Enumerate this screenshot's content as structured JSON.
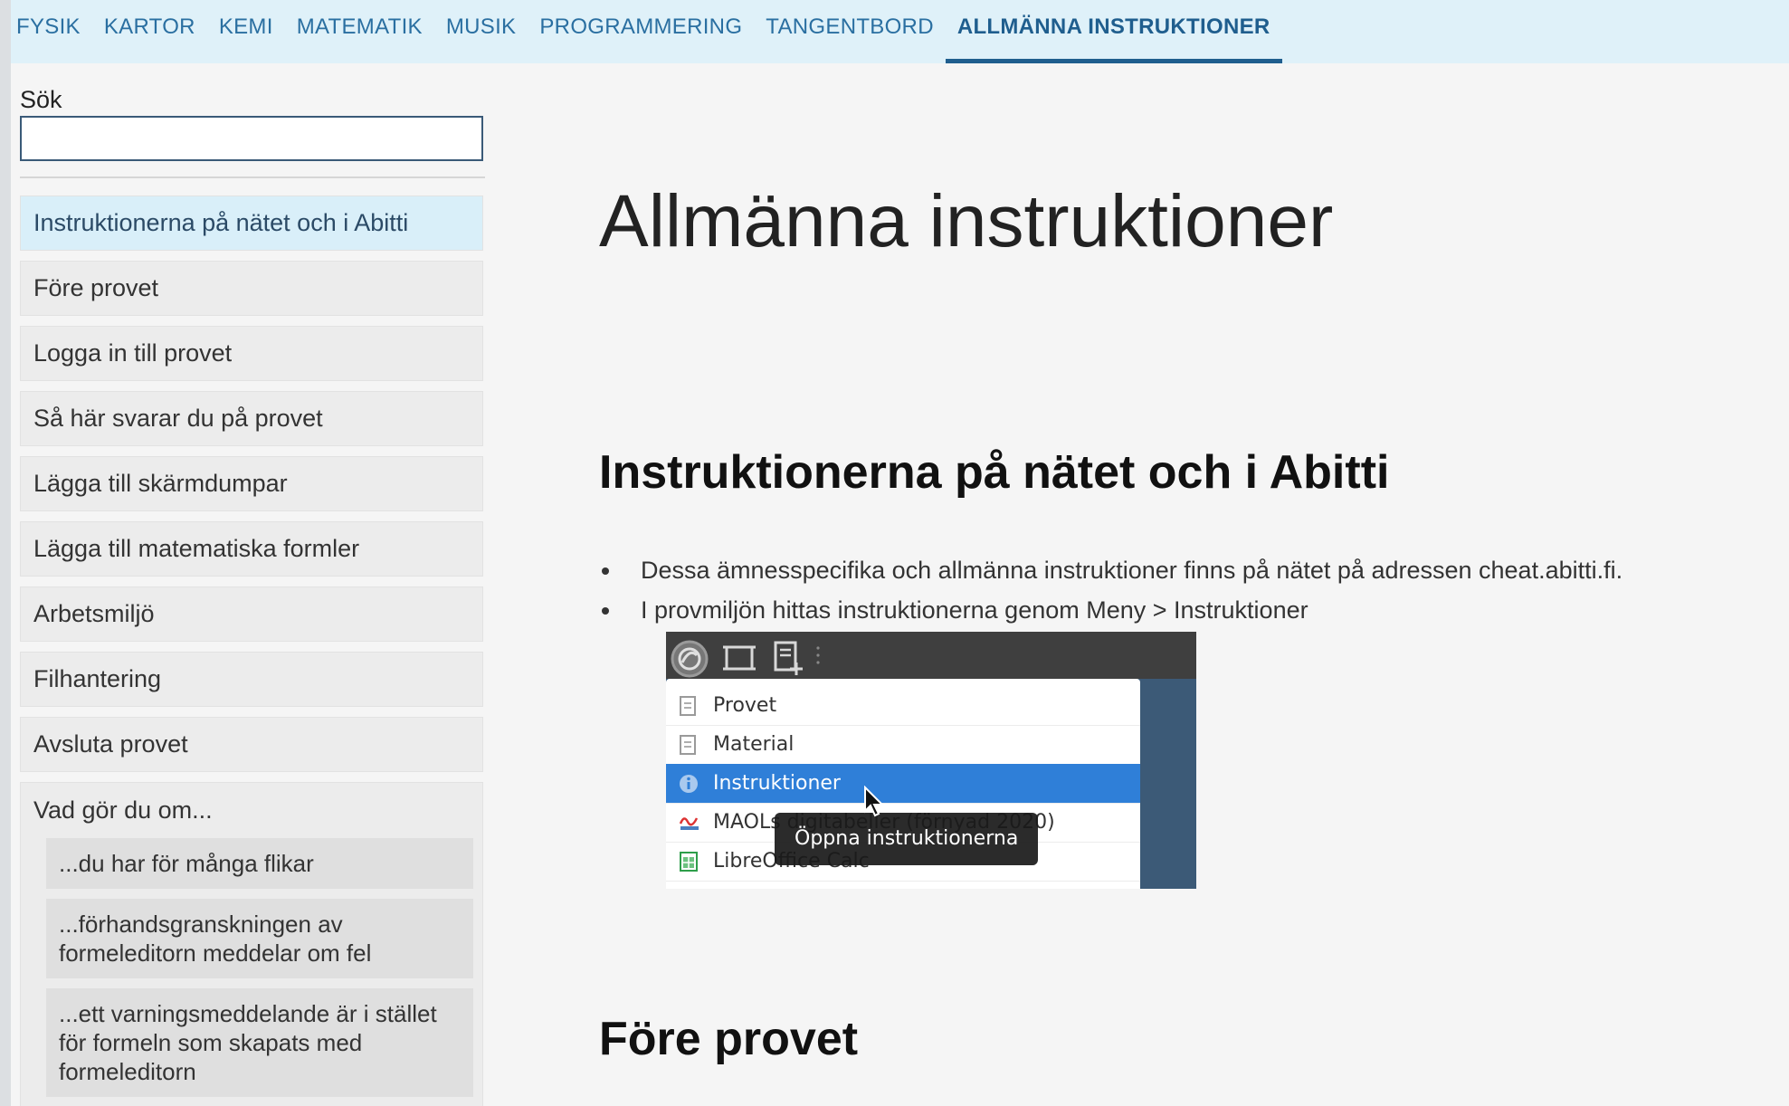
{
  "topnav": {
    "tabs": [
      {
        "label": "FYSIK"
      },
      {
        "label": "KARTOR"
      },
      {
        "label": "KEMI"
      },
      {
        "label": "MATEMATIK"
      },
      {
        "label": "MUSIK"
      },
      {
        "label": "PROGRAMMERING"
      },
      {
        "label": "TANGENTBORD"
      },
      {
        "label": "ALLMÄNNA INSTRUKTIONER",
        "active": true
      }
    ]
  },
  "sidebar": {
    "search_label": "Sök",
    "search_value": "",
    "items": [
      {
        "label": "Instruktionerna på nätet och i Abitti",
        "active": true
      },
      {
        "label": "Före provet"
      },
      {
        "label": "Logga in till provet"
      },
      {
        "label": "Så här svarar du på provet"
      },
      {
        "label": "Lägga till skärmdumpar"
      },
      {
        "label": "Lägga till matematiska formler"
      },
      {
        "label": "Arbetsmiljö"
      },
      {
        "label": "Filhantering"
      },
      {
        "label": "Avsluta provet"
      }
    ],
    "group": {
      "title": "Vad gör du om...",
      "subitems": [
        {
          "label": "...du har för många flikar"
        },
        {
          "label": "...förhandsgranskningen av formeleditorn meddelar om fel"
        },
        {
          "label": "...ett varningsmeddelande är i stället för formeln som skapats med formeleditorn"
        }
      ]
    }
  },
  "main": {
    "title": "Allmänna instruktioner",
    "sections": [
      {
        "heading": "Instruktionerna på nätet och i Abitti",
        "bullets": [
          "Dessa ämnesspecifika och allmänna instruktioner finns på nätet på adressen cheat.abitti.fi.",
          "I provmiljön hittas instruktionerna genom Meny > Instruktioner"
        ]
      },
      {
        "heading": "Före provet"
      }
    ],
    "screenshot": {
      "menu_items": [
        {
          "label": "Provet",
          "icon": "document-icon"
        },
        {
          "label": "Material",
          "icon": "document-icon"
        },
        {
          "label": "Instruktioner",
          "icon": "info-icon",
          "highlight": true
        },
        {
          "label": "MAOLs digitabeller (förnyad 2020)",
          "icon": "maol-icon"
        },
        {
          "label": "LibreOffice Calc",
          "icon": "spreadsheet-icon"
        }
      ],
      "tooltip": "Öppna instruktionerna"
    }
  },
  "colors": {
    "accent": "#1f5e8e",
    "nav_background": "#dff1f9",
    "active_item": "#d9eff9",
    "menu_highlight": "#2f7fd8"
  }
}
